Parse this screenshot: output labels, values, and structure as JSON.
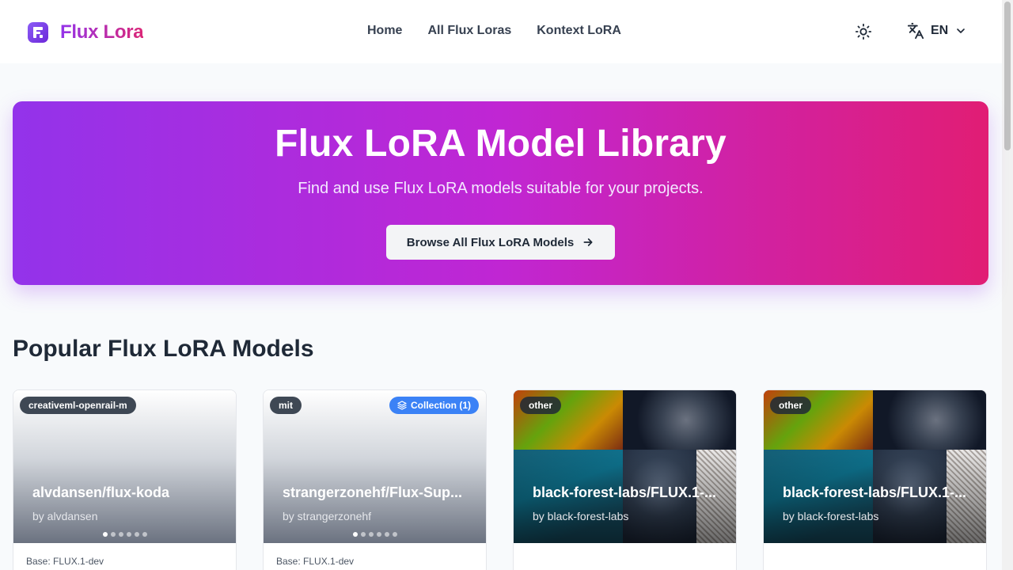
{
  "header": {
    "logo_text": "Flux Lora",
    "nav": [
      {
        "label": "Home"
      },
      {
        "label": "All Flux Loras"
      },
      {
        "label": "Kontext LoRA"
      }
    ],
    "theme_icon": "sun-icon",
    "language": {
      "code": "EN",
      "icon": "translate-icon"
    }
  },
  "hero": {
    "title": "Flux LoRA Model Library",
    "subtitle": "Find and use Flux LoRA models suitable for your projects.",
    "button_label": "Browse All Flux LoRA Models",
    "gradient": [
      "#9333ea",
      "#e11d74"
    ]
  },
  "popular": {
    "title": "Popular Flux LoRA Models",
    "cards": [
      {
        "license": "creativeml-openrail-m",
        "collection": "",
        "title": "alvdansen/flux-koda",
        "author": "by alvdansen",
        "base": "Base: FLUX.1-dev",
        "dots": 6,
        "active_dot": 0
      },
      {
        "license": "mit",
        "collection": "Collection (1)",
        "title": "strangerzonehf/Flux-Sup...",
        "author": "by strangerzonehf",
        "base": "Base: FLUX.1-dev",
        "dots": 6,
        "active_dot": 0
      },
      {
        "license": "other",
        "collection": "",
        "title": "black-forest-labs/FLUX.1-...",
        "author": "by black-forest-labs",
        "base": "",
        "dots": 0,
        "active_dot": 0
      },
      {
        "license": "other",
        "collection": "",
        "title": "black-forest-labs/FLUX.1-...",
        "author": "by black-forest-labs",
        "base": "",
        "dots": 0,
        "active_dot": 0
      }
    ]
  }
}
